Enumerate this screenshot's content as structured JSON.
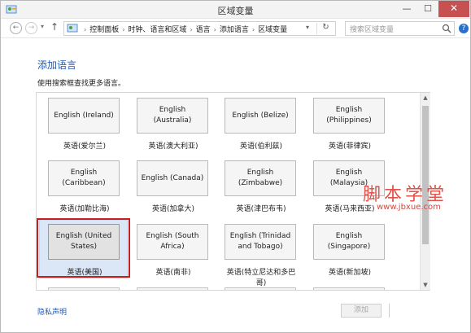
{
  "window": {
    "title": "区域变量",
    "minimize_glyph": "—",
    "maximize_glyph": "☐",
    "close_glyph": "✕"
  },
  "nav": {
    "back_glyph": "←",
    "forward_glyph": "→",
    "history_glyph": "▾",
    "up_glyph": "↑",
    "breadcrumbs": [
      "控制面板",
      "时钟、语言和区域",
      "语言",
      "添加语言",
      "区域变量"
    ],
    "breadcrumb_sep": "›",
    "dropdown_glyph": "▾",
    "refresh_glyph": "↻",
    "search_placeholder": "搜索区域变量",
    "help_glyph": "?"
  },
  "page": {
    "title": "添加语言",
    "instruction": "使用搜索框查找更多语言。"
  },
  "languages": [
    {
      "name": "English (Ireland)",
      "native": "英语(爱尔兰)"
    },
    {
      "name": "English (Australia)",
      "native": "英语(澳大利亚)"
    },
    {
      "name": "English (Belize)",
      "native": "英语(伯利兹)"
    },
    {
      "name": "English (Philippines)",
      "native": "英语(菲律宾)"
    },
    {
      "name": "English (Caribbean)",
      "native": "英语(加勒比海)"
    },
    {
      "name": "English (Canada)",
      "native": "英语(加拿大)"
    },
    {
      "name": "English (Zimbabwe)",
      "native": "英语(津巴布韦)"
    },
    {
      "name": "English (Malaysia)",
      "native": "英语(马来西亚)"
    },
    {
      "name": "English (United States)",
      "native": "英语(美国)"
    },
    {
      "name": "English (South Africa)",
      "native": "英语(南非)"
    },
    {
      "name": "English (Trinidad and Tobago)",
      "native": "英语(特立尼达和多巴哥)"
    },
    {
      "name": "English (Singapore)",
      "native": "英语(新加坡)"
    }
  ],
  "selected_language": "English (United States)",
  "scrollbar": {
    "up_glyph": "▲",
    "down_glyph": "▼"
  },
  "footer": {
    "privacy_link": "隐私声明",
    "add_button": "添加"
  },
  "watermark": {
    "title": "脚本学堂",
    "url": "www.jbxue.com"
  },
  "colors": {
    "link_blue": "#1e5ab4",
    "close_red": "#c75050",
    "highlight_red": "#c81e1e",
    "selection_blue": "#dbe7f7"
  }
}
